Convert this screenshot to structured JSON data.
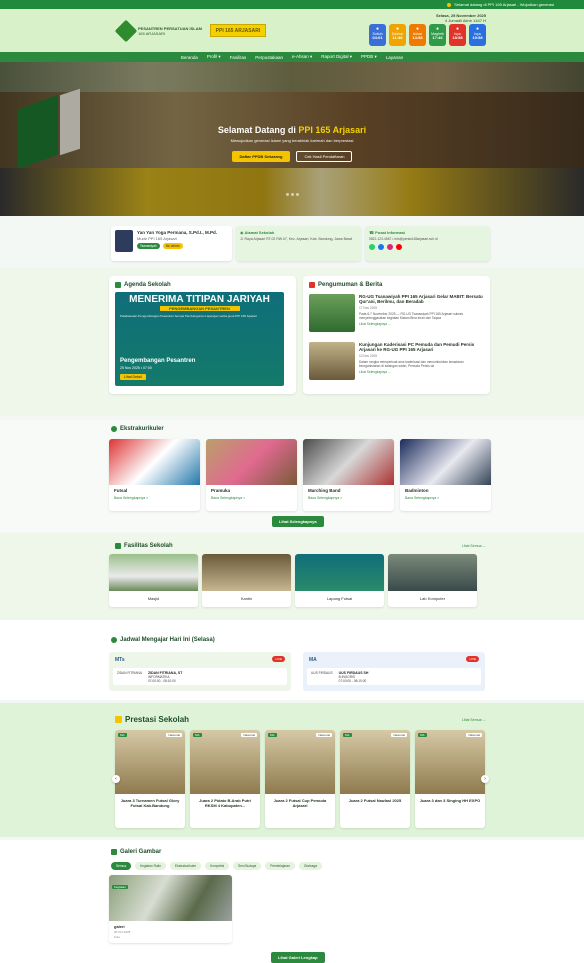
{
  "ticker": "Selamat datang di PPI 165 Arjasari - Wujudkan generasi",
  "header": {
    "school_name": "PESANTREN PERSATUAN ISLAM",
    "school_no": "165 ARJASARI",
    "badge": "PPI 165 ARJASARI",
    "date": "Selasa, 25 November 2025",
    "hijri": "4 Jumadil Akhir 1447 H",
    "prayers": [
      {
        "name": "Subuh",
        "time": "04:01",
        "color": "#3b6fd8",
        "icon": "moon-icon"
      },
      {
        "name": "Dzuhur",
        "time": "11:38",
        "color": "#f0a400",
        "icon": "sun-icon"
      },
      {
        "name": "Ashar",
        "time": "14:58",
        "color": "#f07a00",
        "icon": "sun-icon"
      },
      {
        "name": "Maghrib",
        "time": "17:46",
        "color": "#2f9a4a",
        "icon": "sunset-icon"
      },
      {
        "name": "Isya",
        "time": "18:58",
        "color": "#e0342b",
        "icon": "moon-icon"
      },
      {
        "name": "Isya",
        "time": "19:58",
        "color": "#2a6fe0",
        "icon": "star-icon"
      }
    ]
  },
  "nav": [
    "Beranda",
    "Profil ▾",
    "Fasilitas",
    "Perpustakaan",
    "e-Ahsan ▾",
    "Raport Digital ▾",
    "PPDB ▾",
    "Layanan"
  ],
  "hero": {
    "title_prefix": "Selamat Datang di",
    "title_highlight": "PPI 165 Arjasari",
    "subtitle": "Mewujudkan generasi Islami yang berakhlak karimah dan berprestasi",
    "btn_primary": "Daftar PPDB Sekarang",
    "btn_secondary": "Cek Hasil Pendaftaran"
  },
  "info": {
    "head_name": "Yan Yan Yoga Permana, S.Pd.I., M.Pd.",
    "head_role": "Mudir PPI 165 Arjasari",
    "tags": [
      "Tsanawiyah",
      "Mu'allimin"
    ],
    "address_title": "Alamat Sekolah",
    "address": "Jl. Raya Arjasari RT.02 RW.07, Kec. Arjasari, Kab. Bandung, Jawa Barat",
    "contact_title": "Pusat Informasi",
    "contact": "0822-123-4567 • info@persis165arjasari.sch.id"
  },
  "agenda": {
    "title": "Agenda Sekolah",
    "poster_headline": "MENERIMA TITIPAN JARIYAH",
    "poster_sub": "PENGEMBANGAN PESANTREN",
    "poster_text": "Pelaksanaan Pengembangan Pesantren berupa Pembangunan Lapangan serba guna PPI 165 Arjasari",
    "event_title": "Pengembangan Pesantren",
    "event_meta": "25 Nov 2025 • 07:00",
    "event_btn": "Lihat Detail"
  },
  "news": {
    "title": "Pengumuman & Berita",
    "items": [
      {
        "title": "RG-UG Tsanawiyah PPI 165 Arjasari Gelar MABIT: Bersatu Qur'ani, Berilmu, dan Beradab",
        "date": "17 Nov 2025",
        "text": "Pada 6-7 November 2025 — RG-UG Tsanawiyah PPI 165 Arjasari sukses menyelenggarakan kegiatan Malam Bina Iman dan Taqwa",
        "more": "Lihat Selengkapnya →"
      },
      {
        "title": "Kunjungan Kaderisasi PC Pemuda dan Pemudi Persis Arjasari ke RG-UG PPI 165 Arjasari",
        "date": "10 Nov 2025",
        "text": "Dalam rangka memperkuat arus kaderisasi dan menumbuhkan kesadaran keorganisasian di kalangan santri, Pemuda Persis da",
        "more": "Lihat Selengkapnya →"
      }
    ]
  },
  "ekstra": {
    "title": "Ekstrakurikuler",
    "items": [
      {
        "name": "Futsal",
        "link": "Baca Selengkapnya >"
      },
      {
        "name": "Pramuka",
        "link": "Baca Selengkapnya >"
      },
      {
        "name": "Marching Band",
        "link": "Baca Selengkapnya >"
      },
      {
        "name": "Badminton",
        "link": "Baca Selengkapnya >"
      }
    ],
    "more_btn": "Lihat Selengkapnya"
  },
  "fasilitas": {
    "title": "Fasilitas Sekolah",
    "see_all": "Lihat Semua →",
    "items": [
      "Masjid",
      "Kantin",
      "Lapang Futsal",
      "Lab Komputer"
    ]
  },
  "jadwal": {
    "title": "Jadwal Mengajar Hari Ini (Selasa)",
    "cols": [
      {
        "level": "MTs",
        "badge": "LIVE",
        "teacher": "ZIDAN FITRIANA, ST",
        "subject": "INFORMATIKA",
        "time": "07:00:00 - 08:10:00",
        "class": "ZIDAN FITRIANA"
      },
      {
        "level": "MA",
        "badge": "LIVE",
        "teacher": "UUS FIRDAUS SH",
        "subject": "B.INGGRIS",
        "time": "07:00:00 - 08:10:00",
        "class": "UUS FIRDAUS"
      }
    ]
  },
  "prestasi": {
    "title": "Prestasi Sekolah",
    "see_all": "Lihat Semua →",
    "items": [
      "Juara 3 Turnamen Futsal Glory Futsal Kab.Bandung",
      "Juara 2 Pidato B.Arab Putri RKSM 4 Kabupaten...",
      "Juara 2 Futsal Cup Pemuda Arjasari",
      "Juara 2 Futsal Naufasi 2025",
      "Juara 3 dan 3 Singing HH EXPO"
    ],
    "badge": "MA",
    "badge2": "Nasional"
  },
  "galeri": {
    "title": "Galeri Gambar",
    "chips": [
      "Semua",
      "Kegiatan Rutin",
      "Ekstrakurikuler",
      "Kompetisi",
      "Seni Budaya",
      "Pembelajaran",
      "Olahraga"
    ],
    "item_title": "galeri",
    "item_date": "20 Oct 2025",
    "item_meta": "Foto",
    "item_badge": "Kegiatan",
    "btn": "Lihat Galeri Lengkap"
  }
}
